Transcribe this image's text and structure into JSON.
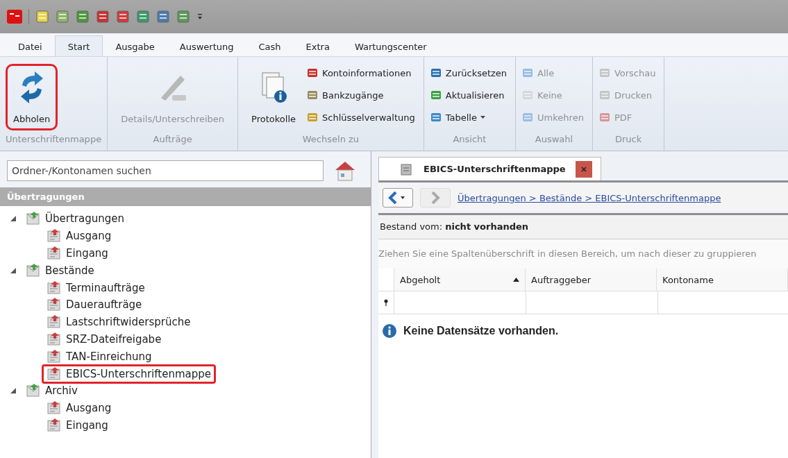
{
  "ribbon_tabs": [
    {
      "label": "Datei",
      "selected": false
    },
    {
      "label": "Start",
      "selected": true
    },
    {
      "label": "Ausgabe",
      "selected": false
    },
    {
      "label": "Auswertung",
      "selected": false
    },
    {
      "label": "Cash",
      "selected": false
    },
    {
      "label": "Extra",
      "selected": false
    },
    {
      "label": "Wartungscenter",
      "selected": false
    }
  ],
  "ribbon_groups": [
    {
      "label": "Unterschriftenmappe",
      "items": [
        {
          "label": "Abholen",
          "kind": "large",
          "disabled": false,
          "highlighted": true
        }
      ]
    },
    {
      "label": "Aufträge",
      "items": [
        {
          "label": "Details/Unterschreiben",
          "kind": "large",
          "disabled": true,
          "highlighted": false
        }
      ]
    },
    {
      "label": "Wechseln zu",
      "items": [
        {
          "label": "Protokolle",
          "kind": "large",
          "disabled": false,
          "highlighted": false
        },
        {
          "label": "Kontoinformationen",
          "kind": "small",
          "disabled": false
        },
        {
          "label": "Bankzugänge",
          "kind": "small",
          "disabled": false
        },
        {
          "label": "Schlüsselverwaltung",
          "kind": "small",
          "disabled": false
        }
      ]
    },
    {
      "label": "Ansicht",
      "items": [
        {
          "label": "Zurücksetzen",
          "kind": "small",
          "disabled": false
        },
        {
          "label": "Aktualisieren",
          "kind": "small",
          "disabled": false
        },
        {
          "label": "Tabelle",
          "kind": "dropdown",
          "disabled": false
        }
      ]
    },
    {
      "label": "Auswahl",
      "items": [
        {
          "label": "Alle",
          "kind": "small",
          "disabled": true
        },
        {
          "label": "Keine",
          "kind": "small",
          "disabled": true
        },
        {
          "label": "Umkehren",
          "kind": "small",
          "disabled": true
        }
      ]
    },
    {
      "label": "Druck",
      "items": [
        {
          "label": "Vorschau",
          "kind": "small",
          "disabled": true
        },
        {
          "label": "Drucken",
          "kind": "small",
          "disabled": true
        },
        {
          "label": "PDF",
          "kind": "small",
          "disabled": true
        }
      ]
    }
  ],
  "sidebar": {
    "search": {
      "placeholder": "Ordner-/Kontonamen suchen"
    },
    "header": "Übertragungen",
    "tree": [
      {
        "label": "Übertragungen",
        "expanded": true,
        "highlighted": false,
        "children": [
          {
            "label": "Ausgang",
            "highlighted": false
          },
          {
            "label": "Eingang",
            "highlighted": false
          }
        ]
      },
      {
        "label": "Bestände",
        "expanded": true,
        "highlighted": false,
        "children": [
          {
            "label": "Terminaufträge",
            "highlighted": false
          },
          {
            "label": "Daueraufträge",
            "highlighted": false
          },
          {
            "label": "Lastschriftwidersprüche",
            "highlighted": false
          },
          {
            "label": "SRZ-Dateifreigabe",
            "highlighted": false
          },
          {
            "label": "TAN-Einreichung",
            "highlighted": false
          },
          {
            "label": "EBICS-Unterschriftenmappe",
            "highlighted": true
          }
        ]
      },
      {
        "label": "Archiv",
        "expanded": true,
        "highlighted": false,
        "children": [
          {
            "label": "Ausgang",
            "highlighted": false
          },
          {
            "label": "Eingang",
            "highlighted": false
          }
        ]
      }
    ]
  },
  "document": {
    "tab": {
      "label": "EBICS-Unterschriftenmappe",
      "selected": true
    },
    "breadcrumb": "Übertragungen > Bestände > EBICS-Unterschriftenmappe",
    "status": "Bestand vom: **nicht vorhanden**",
    "group_hint": "Ziehen Sie eine Spaltenüberschrift in diesen Bereich, um nach dieser zu gruppieren",
    "columns": [
      {
        "label": "Abgeholt",
        "sorted": true
      },
      {
        "label": "Auftraggeber",
        "sorted": false
      },
      {
        "label": "Kontoname",
        "sorted": false
      }
    ],
    "empty_message": "Keine Datensätze vorhanden."
  }
}
